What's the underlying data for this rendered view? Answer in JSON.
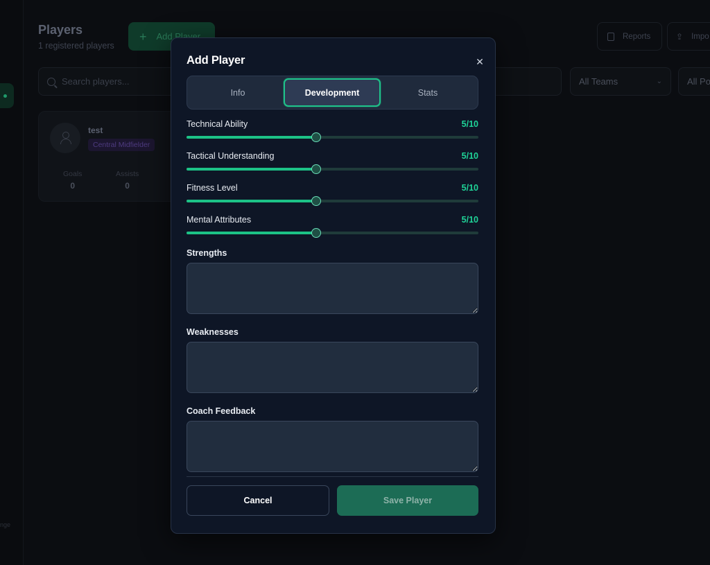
{
  "background": {
    "page_title": "Players",
    "page_subtitle": "1 registered players",
    "add_player_label": "Add Player",
    "search_placeholder": "Search players...",
    "reports_label": "Reports",
    "import_label": "Impo",
    "filter_teams": "All Teams",
    "filter_positions": "All Po",
    "sidebar_footer": "nge",
    "card": {
      "name": "test",
      "position": "Central Midfielder",
      "goals_label": "Goals",
      "goals_value": "0",
      "assists_label": "Assists",
      "assists_value": "0"
    }
  },
  "modal": {
    "title": "Add Player",
    "close_symbol": "✕",
    "tabs": [
      {
        "label": "Info",
        "active": false
      },
      {
        "label": "Development",
        "active": true
      },
      {
        "label": "Stats",
        "active": false
      }
    ],
    "sliders": [
      {
        "label": "Technical Ability",
        "value": 5,
        "max": 10,
        "display": "5/10"
      },
      {
        "label": "Tactical Understanding",
        "value": 5,
        "max": 10,
        "display": "5/10"
      },
      {
        "label": "Fitness Level",
        "value": 5,
        "max": 10,
        "display": "5/10"
      },
      {
        "label": "Mental Attributes",
        "value": 5,
        "max": 10,
        "display": "5/10"
      }
    ],
    "fields": [
      {
        "label": "Strengths",
        "value": ""
      },
      {
        "label": "Weaknesses",
        "value": ""
      },
      {
        "label": "Coach Feedback",
        "value": ""
      }
    ],
    "cancel_label": "Cancel",
    "save_label": "Save Player"
  },
  "colors": {
    "accent": "#1fd498",
    "modal_bg": "#0e1626",
    "save_bg": "#1c6c55"
  }
}
